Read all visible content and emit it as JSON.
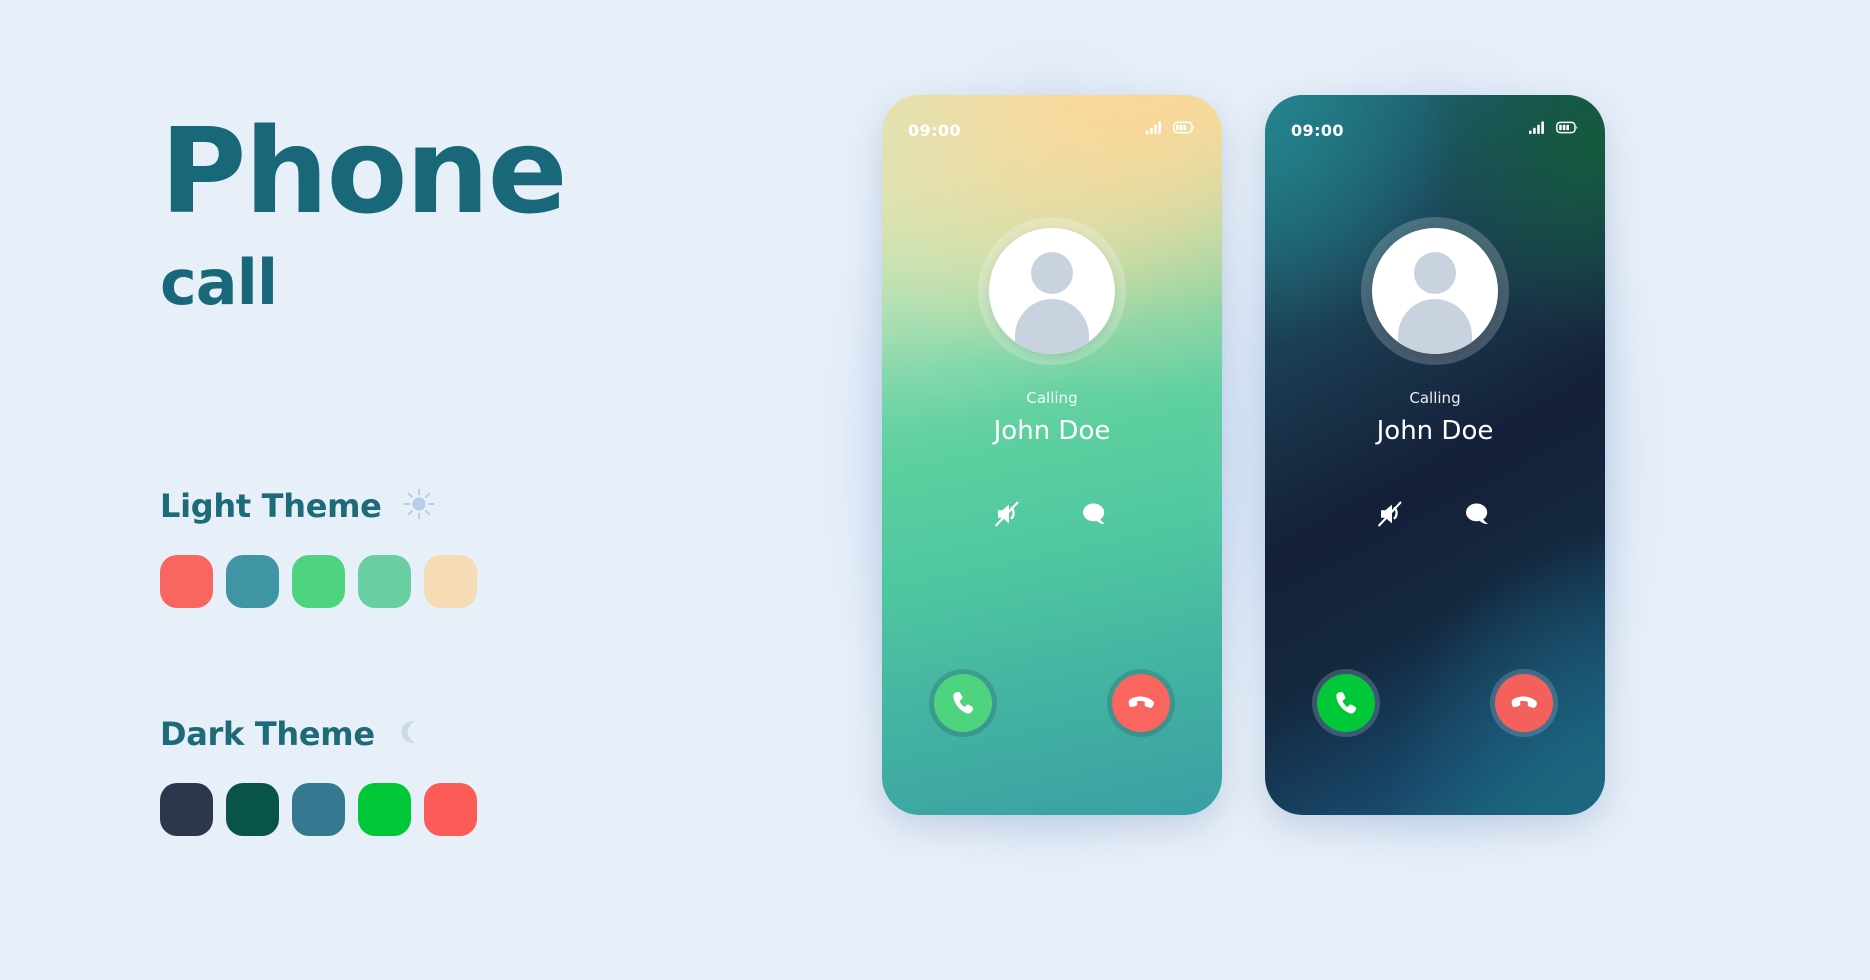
{
  "page": {
    "background_color": "#e7eff8",
    "title_main": "Phone",
    "title_sub": "call",
    "title_color": "#19687a"
  },
  "themes": [
    {
      "key": "light",
      "label": "Light Theme",
      "icon": "sun-icon",
      "icon_color": "#b8cde8",
      "swatches": [
        "#f9655f",
        "#3f95a3",
        "#4ed37e",
        "#69cfa3",
        "#f5dcb4"
      ]
    },
    {
      "key": "dark",
      "label": "Dark Theme",
      "icon": "moon-icon",
      "icon_color": "#ccd9ec",
      "swatches": [
        "#2b374b",
        "#08534a",
        "#34798f",
        "#00c838",
        "#fb5c58"
      ]
    }
  ],
  "phones": [
    {
      "key": "light",
      "theme_name": "light",
      "status": {
        "time": "09:00",
        "signal_icon": "signal-bars-icon",
        "battery_icon": "battery-icon",
        "battery_level": 3
      },
      "contact": {
        "call_status": "Calling",
        "name": "John Doe",
        "avatar_icon": "user-avatar-icon"
      },
      "mid_actions": [
        {
          "name": "mute-icon",
          "label": "Mute"
        },
        {
          "name": "message-icon",
          "label": "Message"
        }
      ],
      "call_actions": [
        {
          "name": "answer-call-button",
          "label": "Answer",
          "icon": "phone-handset-icon",
          "color": "#4ed37e"
        },
        {
          "name": "decline-call-button",
          "label": "Decline",
          "icon": "phone-hangup-icon",
          "color": "#f9655f"
        }
      ]
    },
    {
      "key": "dark",
      "theme_name": "dark",
      "status": {
        "time": "09:00",
        "signal_icon": "signal-bars-icon",
        "battery_icon": "battery-icon",
        "battery_level": 3
      },
      "contact": {
        "call_status": "Calling",
        "name": "John Doe",
        "avatar_icon": "user-avatar-icon"
      },
      "mid_actions": [
        {
          "name": "mute-icon",
          "label": "Mute"
        },
        {
          "name": "message-icon",
          "label": "Message"
        }
      ],
      "call_actions": [
        {
          "name": "answer-call-button",
          "label": "Answer",
          "icon": "phone-handset-icon",
          "color": "#00c838"
        },
        {
          "name": "decline-call-button",
          "label": "Decline",
          "icon": "phone-hangup-icon",
          "color": "#f4615c"
        }
      ]
    }
  ]
}
